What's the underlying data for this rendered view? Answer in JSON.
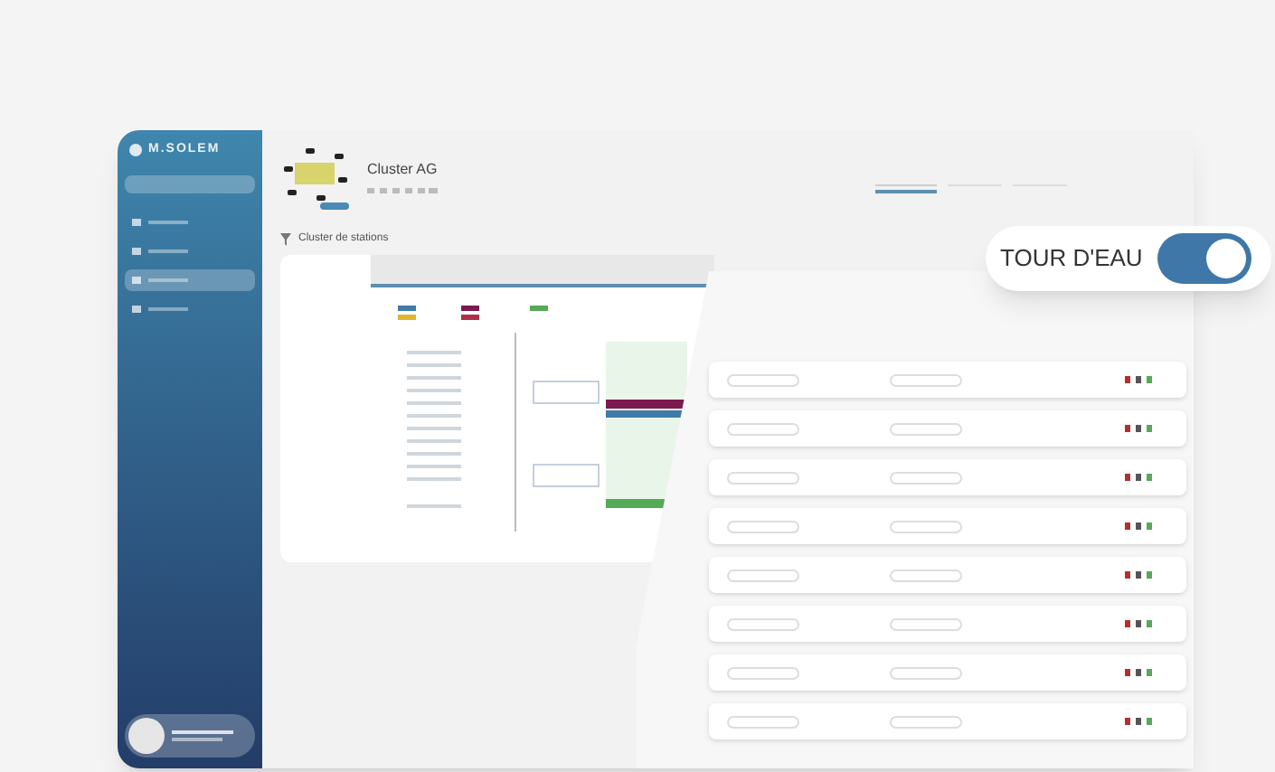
{
  "sidebar": {
    "brand": "M.SOLEM",
    "items": [
      {
        "selected": false
      },
      {
        "selected": false
      },
      {
        "selected": true
      },
      {
        "selected": false
      }
    ]
  },
  "header": {
    "title": "Cluster AG",
    "tabs": [
      {
        "selected": true
      },
      {
        "selected": false
      },
      {
        "selected": false
      }
    ]
  },
  "section": {
    "title": "Cluster de stations"
  },
  "overlay": {
    "label": "TOUR D'EAU",
    "on": true
  }
}
